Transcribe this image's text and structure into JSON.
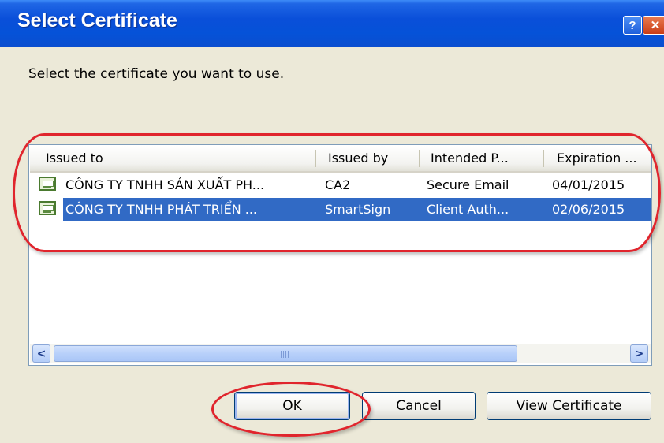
{
  "window": {
    "title": "Select Certificate",
    "help_glyph": "?",
    "close_glyph": "✕"
  },
  "prompt": "Select the certificate you want to use.",
  "table": {
    "columns": [
      "Issued to",
      "Issued by",
      "Intended P...",
      "Expiration ..."
    ],
    "rows": [
      {
        "issued_to": "CÔNG TY TNHH SẢN XUẤT PH...",
        "issued_by": "CA2",
        "intended": "Secure Email",
        "expiration": "04/01/2015",
        "selected": false
      },
      {
        "issued_to": "CÔNG TY TNHH PHÁT TRIỂN ...",
        "issued_by": "SmartSign",
        "intended": "Client Auth...",
        "expiration": "02/06/2015",
        "selected": true
      }
    ],
    "row_icon": "certificate-icon",
    "selection_color": "#316ac5"
  },
  "scrollbar": {
    "left_arrow": "<",
    "right_arrow": ">"
  },
  "buttons": {
    "ok": "OK",
    "cancel": "Cancel",
    "view_certificate": "View Certificate"
  },
  "annotation_color": "#e0252d"
}
